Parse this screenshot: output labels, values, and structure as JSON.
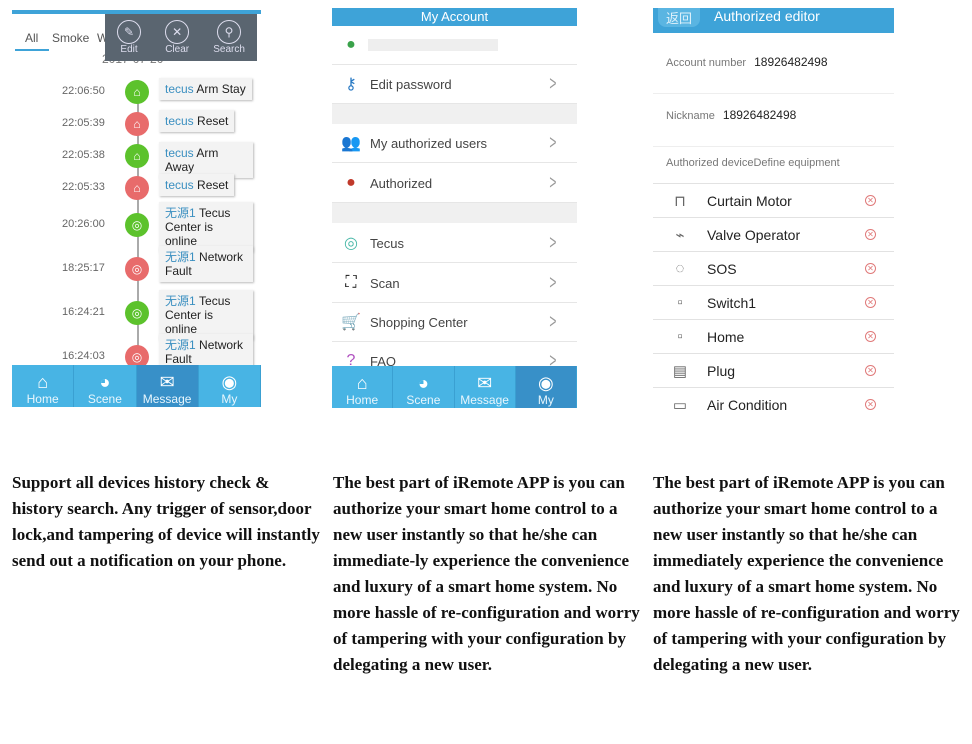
{
  "panel1": {
    "tabs": [
      "All",
      "Smoke",
      "W"
    ],
    "date": "2017-07-20",
    "popup": [
      {
        "icon": "edit-icon",
        "label": "Edit"
      },
      {
        "icon": "close-icon",
        "label": "Clear"
      },
      {
        "icon": "search-icon",
        "label": "Search"
      }
    ],
    "events": [
      {
        "time": "22:06:50",
        "status": "green",
        "name": "tecus",
        "text": "Arm Stay"
      },
      {
        "time": "22:05:39",
        "status": "red",
        "name": "tecus",
        "text": "Reset"
      },
      {
        "time": "22:05:38",
        "status": "green",
        "name": "tecus",
        "text": "Arm Away"
      },
      {
        "time": "22:05:33",
        "status": "red",
        "name": "tecus",
        "text": "Reset"
      },
      {
        "time": "20:26:00",
        "status": "green",
        "name": "无源1",
        "text": "Tecus Center is online"
      },
      {
        "time": "18:25:17",
        "status": "red",
        "name": "无源1",
        "text": "Network Fault"
      },
      {
        "time": "16:24:21",
        "status": "green",
        "name": "无源1",
        "text": "Tecus Center is online"
      },
      {
        "time": "16:24:03",
        "status": "red",
        "name": "无源1",
        "text": "Network Fault"
      }
    ],
    "nav": [
      "Home",
      "Scene",
      "Message",
      "My"
    ],
    "active_nav": "Message"
  },
  "panel2": {
    "title": "My Account",
    "items": [
      "Edit password",
      "My authorized users",
      "Authorized",
      "Tecus",
      "Scan",
      "Shopping Center",
      "FAQ"
    ],
    "nav": [
      "Home",
      "Scene",
      "Message",
      "My"
    ],
    "active_nav": "My"
  },
  "panel3": {
    "back": "返回",
    "title": "Authorized editor",
    "account_label": "Account number",
    "account_value": "18926482498",
    "nickname_label": "Nickname",
    "nickname_value": "18926482498",
    "section": "Authorized deviceDefine equipment",
    "devices": [
      "Curtain Motor",
      "Valve Operator",
      "SOS",
      "Switch1",
      "Home",
      "Plug",
      "Air Condition"
    ]
  },
  "captions": [
    "Support all devices history check & history search. Any trigger of sensor,door lock,and tampering of device will instantly send out a notification on your phone.",
    "The best part of iRemote APP is you can authorize your smart home control to a new user instantly so that he/she can immediate-ly experience the convenience and luxury of a smart home system. No more hassle of re-configuration and worry of tampering with your configuration by delegating a new user.",
    "The best part of iRemote APP is you can authorize your smart home control to a new user instantly so that he/she can immediately experience the convenience and luxury of a smart home system. No more hassle of re-configuration and worry of tampering with your configuration by delegating a new user."
  ],
  "colors": {
    "header": "#3ea3d8",
    "nav": "#48b4e4",
    "ok": "#5cc22c",
    "fault": "#e86b6b"
  }
}
